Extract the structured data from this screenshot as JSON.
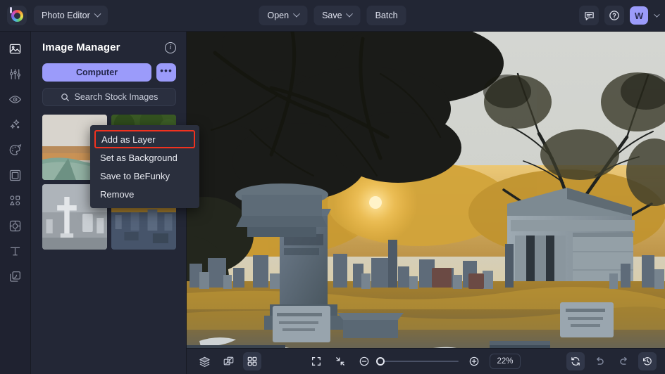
{
  "app": {
    "logo_name": "befunky-logo",
    "mode_label": "Photo Editor"
  },
  "topbar": {
    "open_label": "Open",
    "save_label": "Save",
    "batch_label": "Batch",
    "feedback_icon": "chat-icon",
    "help_icon": "help-circle-icon",
    "avatar_initial": "W",
    "account_chevron": "chevron-down-icon"
  },
  "rail": {
    "items": [
      {
        "name": "sidebar-item-image-manager",
        "icon": "image-icon",
        "active": true
      },
      {
        "name": "sidebar-item-edit",
        "icon": "sliders-icon",
        "active": false
      },
      {
        "name": "sidebar-item-touch-up",
        "icon": "eye-icon",
        "active": false
      },
      {
        "name": "sidebar-item-effects",
        "icon": "sparkles-icon",
        "active": false
      },
      {
        "name": "sidebar-item-artsy",
        "icon": "palette-icon",
        "active": false
      },
      {
        "name": "sidebar-item-frames",
        "icon": "frame-icon",
        "active": false
      },
      {
        "name": "sidebar-item-graphics",
        "icon": "shapes-icon",
        "active": false
      },
      {
        "name": "sidebar-item-overlays",
        "icon": "sticker-icon",
        "active": false
      },
      {
        "name": "sidebar-item-text",
        "icon": "text-icon",
        "active": false
      },
      {
        "name": "sidebar-item-layers",
        "icon": "layers-stack-icon",
        "active": false
      }
    ]
  },
  "panel": {
    "title": "Image Manager",
    "info_icon": "info-icon",
    "computer_label": "Computer",
    "more_label": "•••",
    "search_icon": "search-icon",
    "search_label": "Search Stock Images",
    "thumbnails": [
      {
        "name": "thumbnail-1",
        "alt": "desert road landscape"
      },
      {
        "name": "thumbnail-2",
        "alt": "cemetery with green trees"
      },
      {
        "name": "thumbnail-3",
        "alt": "black and white cemetery cross"
      },
      {
        "name": "thumbnail-4",
        "alt": "cemetery headstones at sunset"
      }
    ]
  },
  "context_menu": {
    "items": [
      {
        "label": "Add as Layer",
        "highlighted": true
      },
      {
        "label": "Set as Background",
        "highlighted": false
      },
      {
        "label": "Save to BeFunky",
        "highlighted": false
      },
      {
        "label": "Remove",
        "highlighted": false
      }
    ]
  },
  "bottombar": {
    "layers_icon": "layers-icon",
    "transform_icon": "transform-icon",
    "grid_icon": "grid-icon",
    "fit_icon": "fit-screen-icon",
    "collapse_icon": "collapse-arrows-icon",
    "zoom_out_icon": "zoom-out-icon",
    "zoom_in_icon": "zoom-in-icon",
    "zoom_value": "22%",
    "zoom_slider_percent": 0,
    "reset_icon": "reset-icon",
    "undo_icon": "undo-icon",
    "redo_icon": "redo-icon",
    "history_icon": "history-icon"
  },
  "colors": {
    "accent": "#9b9bfa",
    "highlight_border": "#f1321f",
    "topbar_bg": "#222634",
    "panel_bg": "#232736",
    "rail_bg": "#1f2230"
  }
}
